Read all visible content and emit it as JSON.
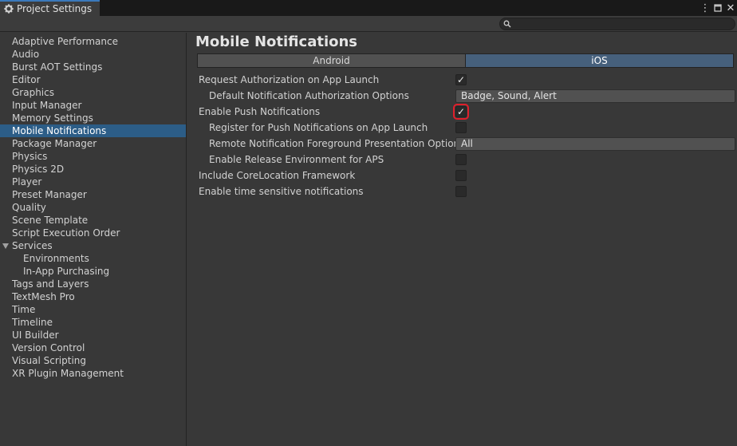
{
  "window": {
    "tab_title": "Project Settings",
    "search": {
      "value": "",
      "placeholder": ""
    }
  },
  "sidebar": {
    "items": [
      {
        "label": "Adaptive Performance"
      },
      {
        "label": "Audio"
      },
      {
        "label": "Burst AOT Settings"
      },
      {
        "label": "Editor"
      },
      {
        "label": "Graphics"
      },
      {
        "label": "Input Manager"
      },
      {
        "label": "Memory Settings"
      },
      {
        "label": "Mobile Notifications",
        "selected": true
      },
      {
        "label": "Package Manager"
      },
      {
        "label": "Physics"
      },
      {
        "label": "Physics 2D"
      },
      {
        "label": "Player"
      },
      {
        "label": "Preset Manager"
      },
      {
        "label": "Quality"
      },
      {
        "label": "Scene Template"
      },
      {
        "label": "Script Execution Order"
      },
      {
        "label": "Services",
        "expanded": true
      },
      {
        "label": "Environments",
        "child": true
      },
      {
        "label": "In-App Purchasing",
        "child": true
      },
      {
        "label": "Tags and Layers"
      },
      {
        "label": "TextMesh Pro"
      },
      {
        "label": "Time"
      },
      {
        "label": "Timeline"
      },
      {
        "label": "UI Builder"
      },
      {
        "label": "Version Control"
      },
      {
        "label": "Visual Scripting"
      },
      {
        "label": "XR Plugin Management"
      }
    ]
  },
  "main": {
    "title": "Mobile Notifications",
    "tabs": [
      {
        "label": "Android",
        "active": false
      },
      {
        "label": "iOS",
        "active": true
      }
    ],
    "settings": {
      "request_auth": {
        "label": "Request Authorization on App Launch",
        "checked": true
      },
      "default_auth_options": {
        "label": "Default Notification Authorization Options",
        "value": "Badge, Sound, Alert"
      },
      "enable_push": {
        "label": "Enable Push Notifications",
        "checked": true
      },
      "register_push": {
        "label": "Register for Push Notifications on App Launch",
        "checked": false
      },
      "remote_foreground": {
        "label": "Remote Notification Foreground Presentation Options",
        "value": "All"
      },
      "release_env": {
        "label": "Enable Release Environment for APS",
        "checked": false
      },
      "core_location": {
        "label": "Include CoreLocation Framework",
        "checked": false
      },
      "time_sensitive": {
        "label": "Enable time sensitive notifications",
        "checked": false
      }
    },
    "check_glyph": "✓"
  },
  "colors": {
    "accent_selected": "#2c5d87",
    "ios_tab_active": "#46607c",
    "highlight_box": "#e01f2b"
  }
}
